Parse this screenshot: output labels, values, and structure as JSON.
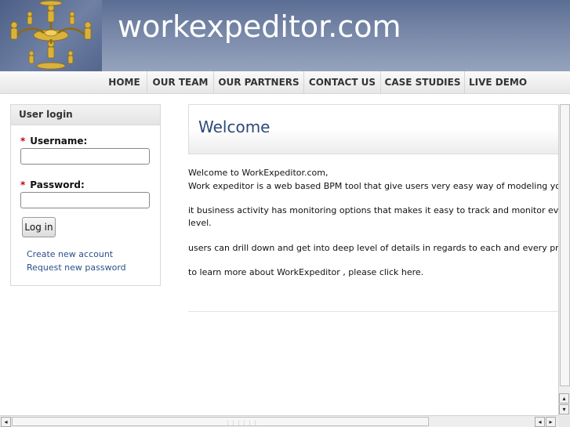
{
  "header": {
    "site_name": "workexpeditor.com"
  },
  "nav": {
    "items": [
      "HOME",
      "OUR TEAM",
      "OUR PARTNERS",
      "CONTACT US",
      "CASE STUDIES",
      "LIVE DEMO"
    ]
  },
  "login": {
    "title": "User login",
    "required_mark": "*",
    "username_label": "Username:",
    "username_value": "",
    "password_label": "Password:",
    "password_value": "",
    "button_label": "Log in",
    "create_account_link": "Create new account",
    "request_password_link": "Request new password"
  },
  "content": {
    "title": "Welcome",
    "paragraphs": [
      "Welcome to WorkExpeditor.com,",
      "Work expeditor is a web based BPM tool that give users very easy way of modeling your business",
      "it business activity has monitoring options that makes it easy to track and monitor every activity go",
      "level.",
      "users can drill down and get into deep level of details in regards to each and every process.",
      "to learn more about WorkExpeditor , please click here."
    ]
  },
  "scrollbars": {
    "left_arrow": "◂",
    "right_arrow": "▸",
    "up_arrow": "▴",
    "down_arrow": "▾",
    "h_grip": "⋮⋮⋮⋮⋮⋮"
  },
  "colors": {
    "header_top": "#5a6d93",
    "header_bottom": "#95a3bd",
    "title_blue": "#2b4a78",
    "link_blue": "#2a4f8c",
    "required_red": "#c00"
  }
}
